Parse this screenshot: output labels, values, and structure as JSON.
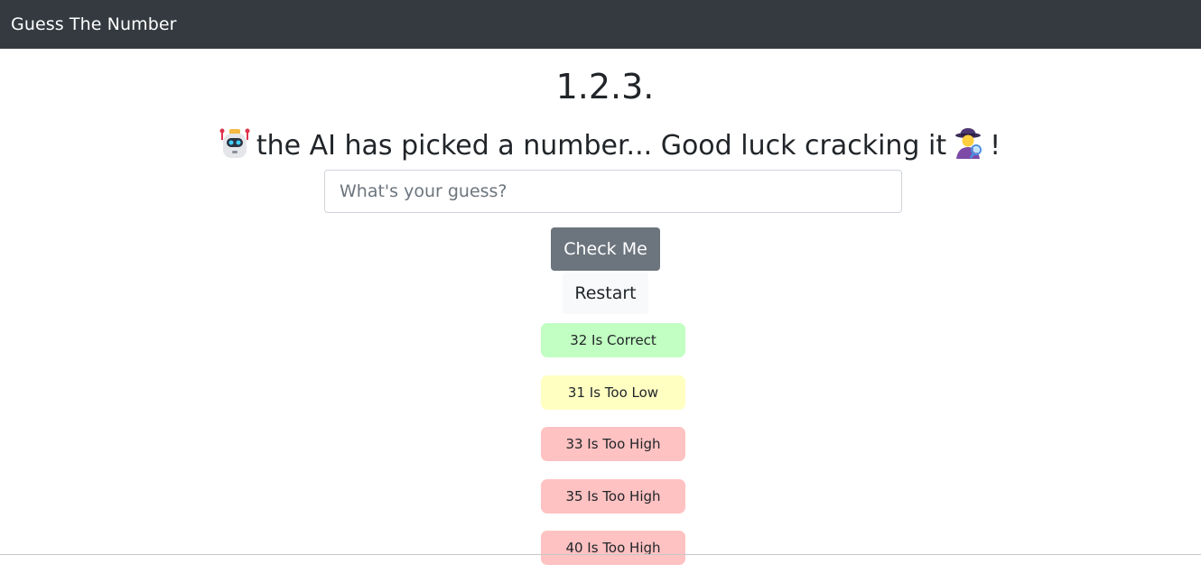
{
  "navbar": {
    "brand": "Guess The Number"
  },
  "main": {
    "version": "1.2.3.",
    "subtitle_before": "the AI has picked a number... Good luck cracking it",
    "subtitle_after": "!",
    "leading_icon": "robot-icon",
    "trailing_icon": "detective-icon",
    "guess_input": {
      "value": "",
      "placeholder": "What's your guess?"
    },
    "check_button": "Check Me",
    "restart_button": "Restart"
  },
  "results": [
    {
      "text": "32 Is Correct",
      "status": "correct",
      "color": "#c2ffc2"
    },
    {
      "text": "31 Is Too Low",
      "status": "low",
      "color": "#ffffc2"
    },
    {
      "text": "33 Is Too High",
      "status": "high",
      "color": "#ffc2c2"
    },
    {
      "text": "35 Is Too High",
      "status": "high",
      "color": "#ffc2c2"
    },
    {
      "text": "40 Is Too High",
      "status": "high",
      "color": "#ffc2c2"
    }
  ],
  "colors": {
    "navbar": "#343a40",
    "check_button": "#6c757d",
    "restart_button": "#f8f9fa"
  }
}
